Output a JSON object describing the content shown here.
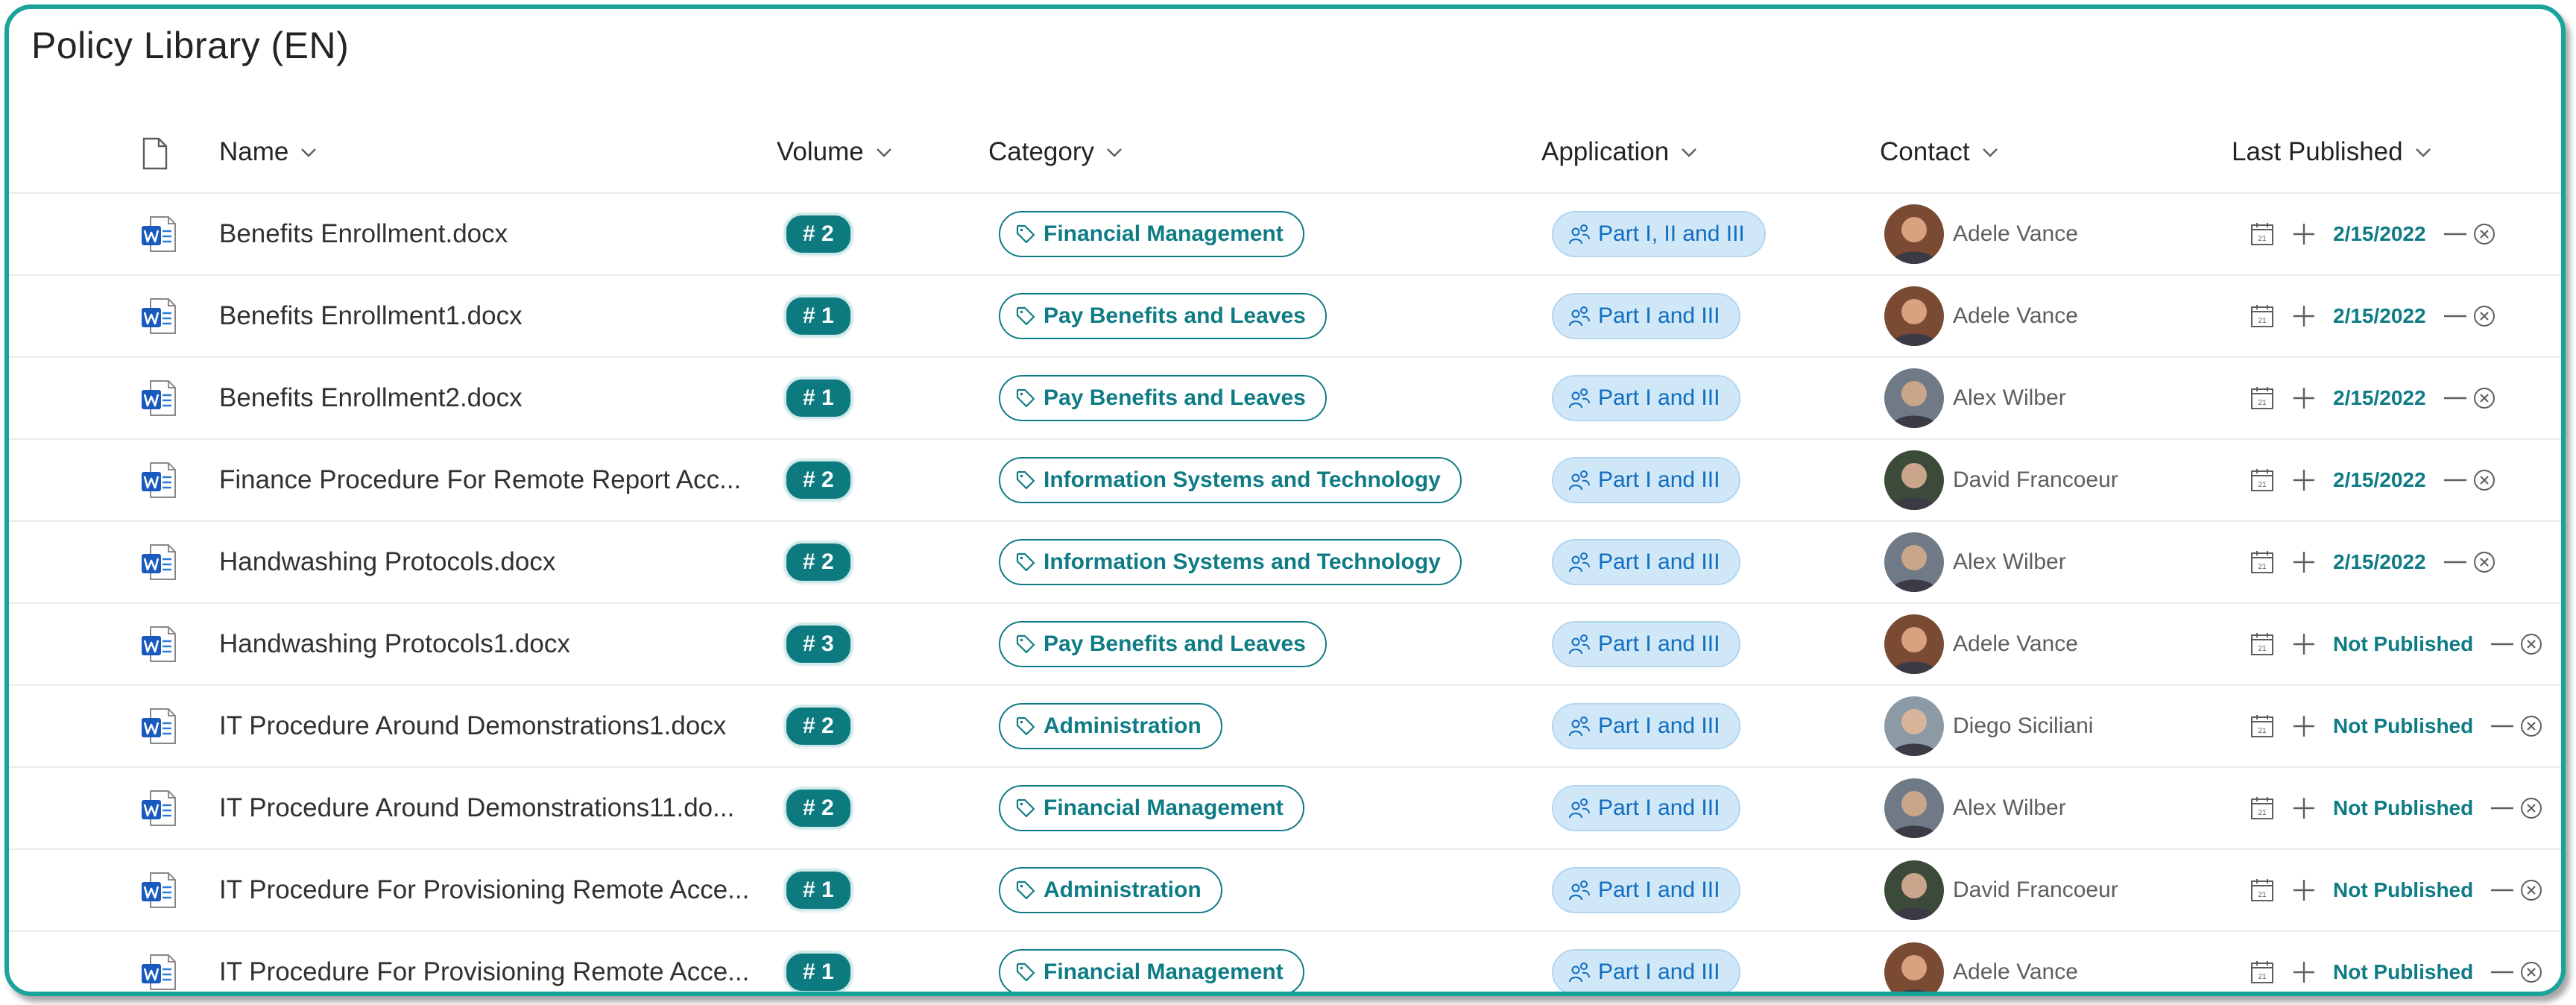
{
  "page_title": "Policy Library (EN)",
  "columns": {
    "name": "Name",
    "volume": "Volume",
    "category": "Category",
    "application": "Application",
    "contact": "Contact",
    "last_published": "Last Published"
  },
  "icons": {
    "file_type": "document-icon",
    "word": "word-doc-icon",
    "tag": "tag-icon",
    "people": "people-icon",
    "calendar": "calendar-icon",
    "add": "plus-icon",
    "clear": "clear-circle-icon",
    "chevron": "chevron-down-icon"
  },
  "colors": {
    "frame": "#1aa39a",
    "volume_badge": "#0d7a80",
    "category_border": "#0f7c85",
    "application_fill": "#d0e7f8",
    "application_text": "#106ebe",
    "date_text": "#0f7c85"
  },
  "rows": [
    {
      "name": "Benefits Enrollment.docx",
      "volume": "# 2",
      "category": "Financial Management",
      "application": "Part I, II and III",
      "contact": "Adele Vance",
      "published": "2/15/2022"
    },
    {
      "name": "Benefits Enrollment1.docx",
      "volume": "# 1",
      "category": "Pay Benefits and Leaves",
      "application": "Part I and III",
      "contact": "Adele Vance",
      "published": "2/15/2022"
    },
    {
      "name": "Benefits Enrollment2.docx",
      "volume": "# 1",
      "category": "Pay Benefits and Leaves",
      "application": "Part I and III",
      "contact": "Alex Wilber",
      "published": "2/15/2022"
    },
    {
      "name": "Finance Procedure For Remote Report Acc...",
      "volume": "# 2",
      "category": "Information Systems and Technology",
      "application": "Part I and III",
      "contact": "David Francoeur",
      "published": "2/15/2022"
    },
    {
      "name": "Handwashing Protocols.docx",
      "volume": "# 2",
      "category": "Information Systems and Technology",
      "application": "Part I and III",
      "contact": "Alex Wilber",
      "published": "2/15/2022"
    },
    {
      "name": "Handwashing Protocols1.docx",
      "volume": "# 3",
      "category": "Pay Benefits and Leaves",
      "application": "Part I and III",
      "contact": "Adele Vance",
      "published": "Not Published"
    },
    {
      "name": "IT Procedure Around Demonstrations1.docx",
      "volume": "# 2",
      "category": "Administration",
      "application": "Part I and III",
      "contact": "Diego Siciliani",
      "published": "Not Published"
    },
    {
      "name": "IT Procedure Around Demonstrations11.do...",
      "volume": "# 2",
      "category": "Financial Management",
      "application": "Part I and III",
      "contact": "Alex Wilber",
      "published": "Not Published"
    },
    {
      "name": "IT Procedure For Provisioning Remote Acce...",
      "volume": "# 1",
      "category": "Administration",
      "application": "Part I and III",
      "contact": "David Francoeur",
      "published": "Not Published"
    },
    {
      "name": "IT Procedure For Provisioning Remote Acce...",
      "volume": "# 1",
      "category": "Financial Management",
      "application": "Part I and III",
      "contact": "Adele Vance",
      "published": "Not Published"
    }
  ]
}
